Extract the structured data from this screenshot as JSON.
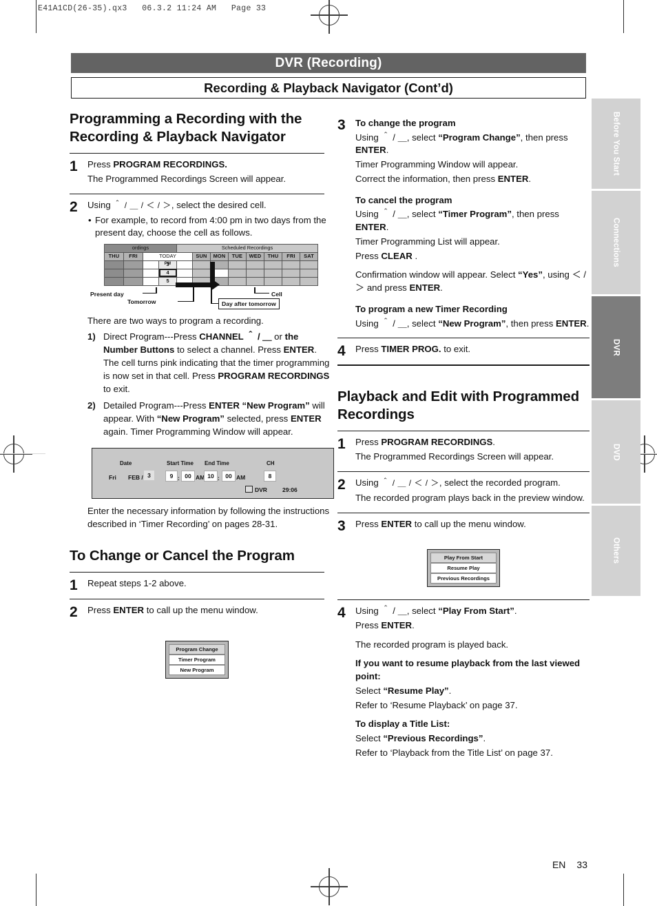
{
  "file_header": "E41A1CD(26-35).qx3   06.3.2 11:24 AM   Page 33",
  "header": {
    "title": "DVR (Recording)",
    "subtitle": "Recording & Playback Navigator (Cont’d)"
  },
  "side_tabs": [
    {
      "label": "Before You Start",
      "active": false
    },
    {
      "label": "Connections",
      "active": false
    },
    {
      "label": "DVR",
      "active": true
    },
    {
      "label": "DVD",
      "active": false
    },
    {
      "label": "Others",
      "active": false
    }
  ],
  "left_column": {
    "heading": "Programming a Recording with the Recording & Playback Navigator",
    "step1": {
      "num": "1",
      "line1_pre": "Press ",
      "line1_bold": "PROGRAM RECORDINGS.",
      "line2": "The Programmed Recordings Screen will appear."
    },
    "step2": {
      "num": "2",
      "line1_pre": "Using ",
      "line1_keys": "＾ / ＿ / ＜ / ＞",
      "line1_post": ", select the desired cell.",
      "bullet": "For example, to record from 4:00 pm in two days from the present day, choose the cell as follows."
    },
    "grid": {
      "title_left": "ordings",
      "title_right": "Scheduled Recordings",
      "past_days": [
        "THU",
        "FRI"
      ],
      "today_label": "TODAY",
      "future_days": [
        "SUN",
        "MON",
        "TUE",
        "WED",
        "THU",
        "FRI",
        "SAT"
      ],
      "hours": [
        "3",
        "4",
        "5"
      ],
      "meridiem": "PM",
      "selected_hour": "4",
      "callouts": {
        "present_day": "Present day",
        "tomorrow": "Tomorrow",
        "day_after_tomorrow": "Day after tomorrow",
        "cell": "Cell"
      }
    },
    "intro_ways": "There are two ways to program a recording.",
    "way1": {
      "marker": "1)",
      "segments": [
        {
          "t": "Direct Program---Press ",
          "b": false
        },
        {
          "t": "CHANNEL ",
          "b": true
        },
        {
          "t": "＾ / ＿",
          "b": true
        },
        {
          "t": " or ",
          "b": false
        },
        {
          "t": "the Number Buttons ",
          "b": true
        },
        {
          "t": "to select a channel. Press ",
          "b": false
        },
        {
          "t": "ENTER",
          "b": true
        },
        {
          "t": ". The cell turns pink indicating that the timer programming is now set in that cell. Press ",
          "b": false
        },
        {
          "t": "PROGRAM RECORDINGS ",
          "b": true
        },
        {
          "t": "to exit.",
          "b": false
        }
      ]
    },
    "way2": {
      "marker": "2)",
      "segments": [
        {
          "t": "Detailed Program---Press ",
          "b": false
        },
        {
          "t": "ENTER",
          "b": true
        },
        {
          "t": " ",
          "b": false
        },
        {
          "t": "“New Program” ",
          "b": true
        },
        {
          "t": "will appear. With ",
          "b": false
        },
        {
          "t": "“New Program” ",
          "b": true
        },
        {
          "t": "selected, press ",
          "b": false
        },
        {
          "t": "ENTER ",
          "b": true
        },
        {
          "t": "again. Timer Programming Window will appear.",
          "b": false
        }
      ]
    },
    "timer_window": {
      "date_label": "Date",
      "start_label": "Start Time",
      "end_label": "End Time",
      "ch_label": "CH",
      "weekday": "Fri",
      "month": "FEB /",
      "day": "3",
      "start_hour": "9",
      "start_min": "00",
      "start_ampm": "AM",
      "end_hour": "10",
      "end_min": "00",
      "end_ampm": "AM",
      "channel": "8",
      "dvr_label": "DVR",
      "remaining": "29:06",
      "colon": ":"
    },
    "after_figure": "Enter the necessary information by following the instructions described in ‘Timer Recording’ on pages 28-31.",
    "heading2": "To Change or Cancel the Program",
    "step1b": {
      "num": "1",
      "text": "Repeat steps 1-2 above."
    },
    "step2b": {
      "num": "2",
      "pre": "Press ",
      "bold": "ENTER",
      "post": " to call up the menu window."
    },
    "menu_window": {
      "items": [
        "Program Change",
        "Timer Program",
        "New Program"
      ]
    }
  },
  "right_column": {
    "step3": {
      "num": "3",
      "sub1_title": "To change the program",
      "sub1_lines": [
        [
          {
            "t": "Using ",
            "b": false
          },
          {
            "t": "＾ / ＿",
            "b": false
          },
          {
            "t": ", select ",
            "b": false
          },
          {
            "t": "“Program Change”",
            "b": true
          },
          {
            "t": ", then press ",
            "b": false
          },
          {
            "t": "ENTER",
            "b": true
          },
          {
            "t": ".",
            "b": false
          }
        ],
        [
          {
            "t": "Timer Programming Window will appear.",
            "b": false
          }
        ],
        [
          {
            "t": "Correct the information, then press ",
            "b": false
          },
          {
            "t": "ENTER",
            "b": true
          },
          {
            "t": ".",
            "b": false
          }
        ]
      ],
      "sub2_title": "To cancel the program",
      "sub2_lines": [
        [
          {
            "t": "Using ",
            "b": false
          },
          {
            "t": "＾ / ＿",
            "b": false
          },
          {
            "t": ", select ",
            "b": false
          },
          {
            "t": "“Timer Program”",
            "b": true
          },
          {
            "t": ", then press ",
            "b": false
          },
          {
            "t": "ENTER",
            "b": true
          },
          {
            "t": ".",
            "b": false
          }
        ],
        [
          {
            "t": "Timer Programming List will appear.",
            "b": false
          }
        ],
        [
          {
            "t": "Press ",
            "b": false
          },
          {
            "t": "CLEAR",
            "b": true
          },
          {
            "t": " .",
            "b": false
          }
        ]
      ],
      "sub2_extra": [
        [
          {
            "t": "Confirmation window will appear. Select ",
            "b": false
          },
          {
            "t": "“Yes”",
            "b": true
          },
          {
            "t": ", using ",
            "b": false
          },
          {
            "t": "＜ / ＞",
            "b": false
          },
          {
            "t": " and press ",
            "b": false
          },
          {
            "t": "ENTER",
            "b": true
          },
          {
            "t": ".",
            "b": false
          }
        ]
      ],
      "sub3_title": "To program a new Timer Recording",
      "sub3_lines": [
        [
          {
            "t": "Using ",
            "b": false
          },
          {
            "t": "＾ / ＿",
            "b": false
          },
          {
            "t": ", select ",
            "b": false
          },
          {
            "t": "“New Program”",
            "b": true
          },
          {
            "t": ", then press ",
            "b": false
          },
          {
            "t": "ENTER",
            "b": true
          },
          {
            "t": ".",
            "b": false
          }
        ]
      ]
    },
    "step4": {
      "num": "4",
      "pre": "Press ",
      "bold": "TIMER PROG.",
      "post": " to exit."
    },
    "heading": "Playback and Edit with Programmed Recordings",
    "pstep1": {
      "num": "1",
      "pre": "Press ",
      "bold": "PROGRAM RECORDINGS",
      "post": ".",
      "line2": "The Programmed Recordings Screen will appear."
    },
    "pstep2": {
      "num": "2",
      "pre": "Using ",
      "keys": "＾ / ＿ / ＜ / ＞",
      "post": ", select the recorded program.",
      "line2": "The recorded program plays back in the preview window."
    },
    "pstep3": {
      "num": "3",
      "pre": "Press ",
      "bold": "ENTER",
      "post": " to call up the menu window."
    },
    "menu_window": {
      "items": [
        "Play From Start",
        "Resume Play",
        "Previous Recordings"
      ]
    },
    "pstep4": {
      "num": "4",
      "l1": [
        {
          "t": "Using ",
          "b": false
        },
        {
          "t": "＾ / ＿",
          "b": false
        },
        {
          "t": ", select ",
          "b": false
        },
        {
          "t": "“Play From Start”",
          "b": true
        },
        {
          "t": ".",
          "b": false
        }
      ],
      "l2": [
        {
          "t": "Press ",
          "b": false
        },
        {
          "t": "ENTER",
          "b": true
        },
        {
          "t": ".",
          "b": false
        }
      ],
      "l3": [
        {
          "t": "The recorded program is played back.",
          "b": false
        }
      ],
      "h1": "If you want to resume playback from the last viewed point:",
      "l4": [
        {
          "t": "Select ",
          "b": false
        },
        {
          "t": "“Resume Play”",
          "b": true
        },
        {
          "t": ".",
          "b": false
        }
      ],
      "l5": [
        {
          "t": "Refer to ‘Resume Playback’ on page 37.",
          "b": false
        }
      ],
      "h2": "To display a Title List:",
      "l6": [
        {
          "t": "Select ",
          "b": false
        },
        {
          "t": "“Previous Recordings”",
          "b": true
        },
        {
          "t": ".",
          "b": false
        }
      ],
      "l7": [
        {
          "t": "Refer to ‘Playback from the Title List’ on page 37.",
          "b": false
        }
      ]
    }
  },
  "footer": {
    "lang": "EN",
    "page": "33"
  },
  "colors": {
    "title_bar": "#636363",
    "active_tab": "#7d7d7d",
    "inactive_tab": "#d2d2d2"
  }
}
